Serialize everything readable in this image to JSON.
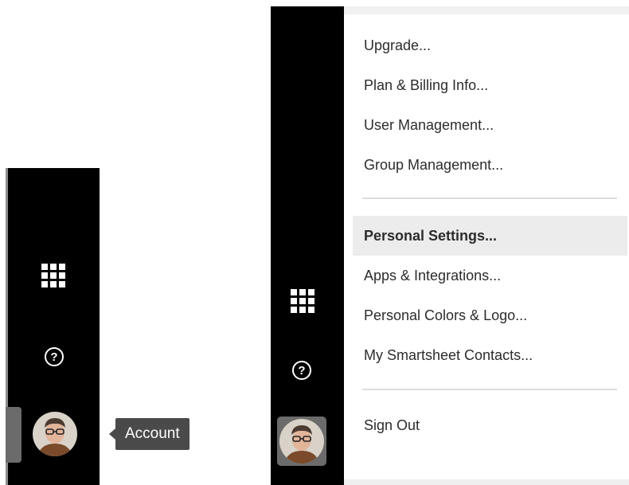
{
  "left": {
    "tooltip": "Account",
    "icons": {
      "apps": "apps-grid-icon",
      "help": "help-icon",
      "help_glyph": "?",
      "account": "account-avatar"
    }
  },
  "right": {
    "menu": {
      "items": [
        {
          "label": "Upgrade..."
        },
        {
          "label": "Plan & Billing Info..."
        },
        {
          "label": "User Management..."
        },
        {
          "label": "Group Management..."
        },
        {
          "label": "Personal Settings...",
          "state": "hover"
        },
        {
          "label": "Apps & Integrations..."
        },
        {
          "label": "Personal Colors & Logo..."
        },
        {
          "label": "My Smartsheet Contacts..."
        },
        {
          "label": "Sign Out"
        }
      ]
    },
    "icons": {
      "apps": "apps-grid-icon",
      "help": "help-icon",
      "help_glyph": "?",
      "account": "account-avatar"
    }
  },
  "colors": {
    "rail": "#000000",
    "menu_hover": "#ececec",
    "tooltip_bg": "#4a4a4a",
    "avatar_frame": "#6b6b6b"
  }
}
